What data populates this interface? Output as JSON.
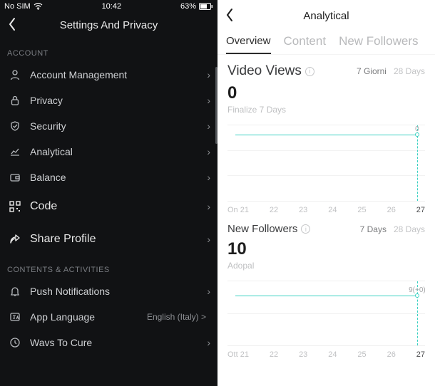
{
  "status_bar": {
    "carrier": "No SIM",
    "time": "10:42",
    "battery_pct": "63%"
  },
  "left": {
    "title": "Settings And Privacy",
    "sections": {
      "account": {
        "label": "ACCOUNT",
        "items": [
          {
            "icon": "user",
            "label": "Account Management"
          },
          {
            "icon": "lock",
            "label": "Privacy"
          },
          {
            "icon": "shield",
            "label": "Security"
          },
          {
            "icon": "chart",
            "label": "Analytical"
          },
          {
            "icon": "wallet",
            "label": "Balance"
          },
          {
            "icon": "qr",
            "label": "Code",
            "em": true
          },
          {
            "icon": "share",
            "label": "Share Profile",
            "em": true
          }
        ]
      },
      "content": {
        "label": "CONTENTS & ACTIVITIES",
        "items": [
          {
            "icon": "bell",
            "label": "Push Notifications"
          },
          {
            "icon": "lang",
            "label": "App Language",
            "extra": "English (Italy) >"
          },
          {
            "icon": "history",
            "label": "Wavs To Cure"
          }
        ]
      }
    }
  },
  "right": {
    "title": "Analytical",
    "tabs": {
      "overview": "Overview",
      "content": "Content",
      "followers": "New Followers"
    },
    "views_block": {
      "title": "Video Views",
      "range_a": "7 Giorni",
      "range_b": "28 Days",
      "value": "0",
      "sub": "Finalize 7 Days"
    },
    "followers_block": {
      "title": "New Followers",
      "range_a": "7 Days",
      "range_b": "28 Days",
      "value": "10",
      "sub": "Adopal"
    }
  },
  "chart_data": [
    {
      "type": "line",
      "title": "Video Views",
      "ylabel": "",
      "xlabel": "",
      "categories": [
        "On 21",
        "22",
        "23",
        "24",
        "25",
        "26",
        "27"
      ],
      "series": [
        {
          "name": "views",
          "values": [
            0,
            0,
            0,
            0,
            0,
            0,
            0
          ]
        }
      ],
      "highlight_index": 6,
      "highlight_label": "0",
      "line_y_pct": 12
    },
    {
      "type": "line",
      "title": "New Followers",
      "ylabel": "",
      "xlabel": "",
      "categories": [
        "Ott 21",
        "22",
        "23",
        "24",
        "25",
        "26",
        "27"
      ],
      "series": [
        {
          "name": "followers",
          "values": [
            9,
            9,
            9,
            9,
            9,
            9,
            9
          ]
        }
      ],
      "highlight_index": 6,
      "highlight_label": "9(+0)",
      "line_y_pct": 22
    }
  ]
}
